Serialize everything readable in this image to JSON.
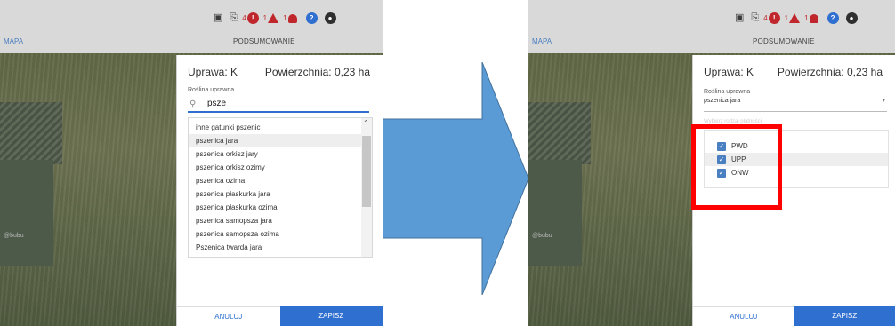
{
  "colors": {
    "accent": "#2f6fd0",
    "warning": "#c0272d",
    "highlight": "#ff0000",
    "arrow": "#5b9bd5"
  },
  "left": {
    "topbar": {
      "mapa": "MAPA",
      "summary": "PODSUMOWANIE",
      "counts": [
        "4",
        "1",
        "1"
      ]
    },
    "map_label": "@bubu",
    "modal": {
      "title": "Uprawa: K",
      "area": "Powierzchnia: 0,23 ha",
      "field_label": "Roślina uprawna",
      "search_value": "psze",
      "options": [
        "inne gatunki pszenic",
        "pszenica jara",
        "pszenica orkisz jary",
        "pszenica orkisz ozimy",
        "pszenica ozima",
        "pszenica płaskurka jara",
        "pszenica płaskurka ozima",
        "pszenica samopsza jara",
        "pszenica samopsza ozima",
        "Pszenica twarda jara"
      ],
      "cancel": "ANULUJ",
      "save": "ZAPISZ"
    }
  },
  "right": {
    "topbar": {
      "mapa": "MAPA",
      "summary": "PODSUMOWANIE",
      "counts": [
        "4",
        "1",
        "1"
      ]
    },
    "map_label": "@bubu",
    "modal": {
      "title": "Uprawa: K",
      "area": "Powierzchnia: 0,23 ha",
      "field_label": "Roślina uprawna",
      "field_value": "pszenica jara",
      "faded_label": "Wybierz rodzaj płatności",
      "checks": [
        "PWD",
        "UPP",
        "ONW"
      ],
      "cancel": "ANULUJ",
      "save": "ZAPISZ"
    }
  }
}
